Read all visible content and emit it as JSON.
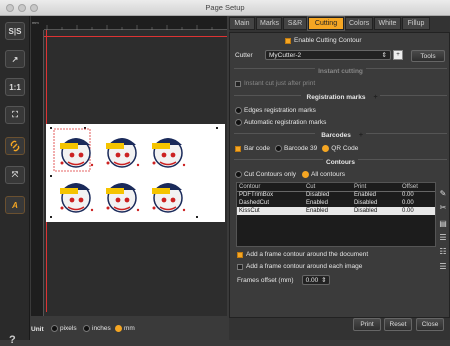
{
  "window": {
    "title": "Page Setup"
  },
  "toolbar": {
    "tools": [
      {
        "name": "split-icon",
        "glyph": "S|S"
      },
      {
        "name": "export-icon",
        "glyph": "↗"
      },
      {
        "name": "one-to-one-icon",
        "glyph": "1:1"
      },
      {
        "name": "fit-page-icon",
        "glyph": "⛶"
      },
      {
        "name": "link-icon",
        "glyph": "🔗"
      },
      {
        "name": "fit-content-icon",
        "glyph": "⤧"
      },
      {
        "name": "auto-text-icon",
        "glyph": "A"
      }
    ],
    "help": "?"
  },
  "ruler": {
    "unit_label": "mm"
  },
  "units": {
    "label": "Unit",
    "options": [
      "pixels",
      "inches",
      "mm"
    ],
    "selected": "mm"
  },
  "tabs": [
    "Main",
    "Marks",
    "S&R",
    "Cutting",
    "Colors",
    "White",
    "Fillup"
  ],
  "active_tab": "Cutting",
  "cutting": {
    "enable_label": "Enable Cutting Contour",
    "cutter_label": "Cutter",
    "cutter_value": "MyCutter-2",
    "tools_button": "Tools",
    "instant_section": "Instant cutting",
    "instant_label": "Instant cut just after print",
    "reg_section": "Registration marks",
    "reg_options": [
      "Edges registration marks",
      "Automatic registration marks"
    ],
    "barcode_section": "Barcodes",
    "barcode_check": "Bar code",
    "barcode_options": [
      "Barcode 39",
      "QR Code"
    ],
    "barcode_selected": "QR Code",
    "contours_section": "Contours",
    "contour_modes": [
      "Cut Contours only",
      "All contours"
    ],
    "contour_mode_selected": "All contours",
    "table_headers": [
      "Contour",
      "Cut",
      "Print",
      "Offset"
    ],
    "table_rows": [
      [
        "PDFTrimBox",
        "Disabled",
        "Enabled",
        "0.00"
      ],
      [
        "DashedCut",
        "Enabled",
        "Disabled",
        "0.00"
      ],
      [
        "KissCut",
        "Enabled",
        "Disabled",
        "0.00"
      ]
    ],
    "selected_row": 2,
    "frame_doc": "Add a frame contour around the document",
    "frame_each": "Add a frame contour around each image",
    "frames_offset_label": "Frames offset (mm)",
    "frames_offset_value": "0.00"
  },
  "footer": {
    "print": "Print",
    "reset": "Reset",
    "close": "Close"
  }
}
